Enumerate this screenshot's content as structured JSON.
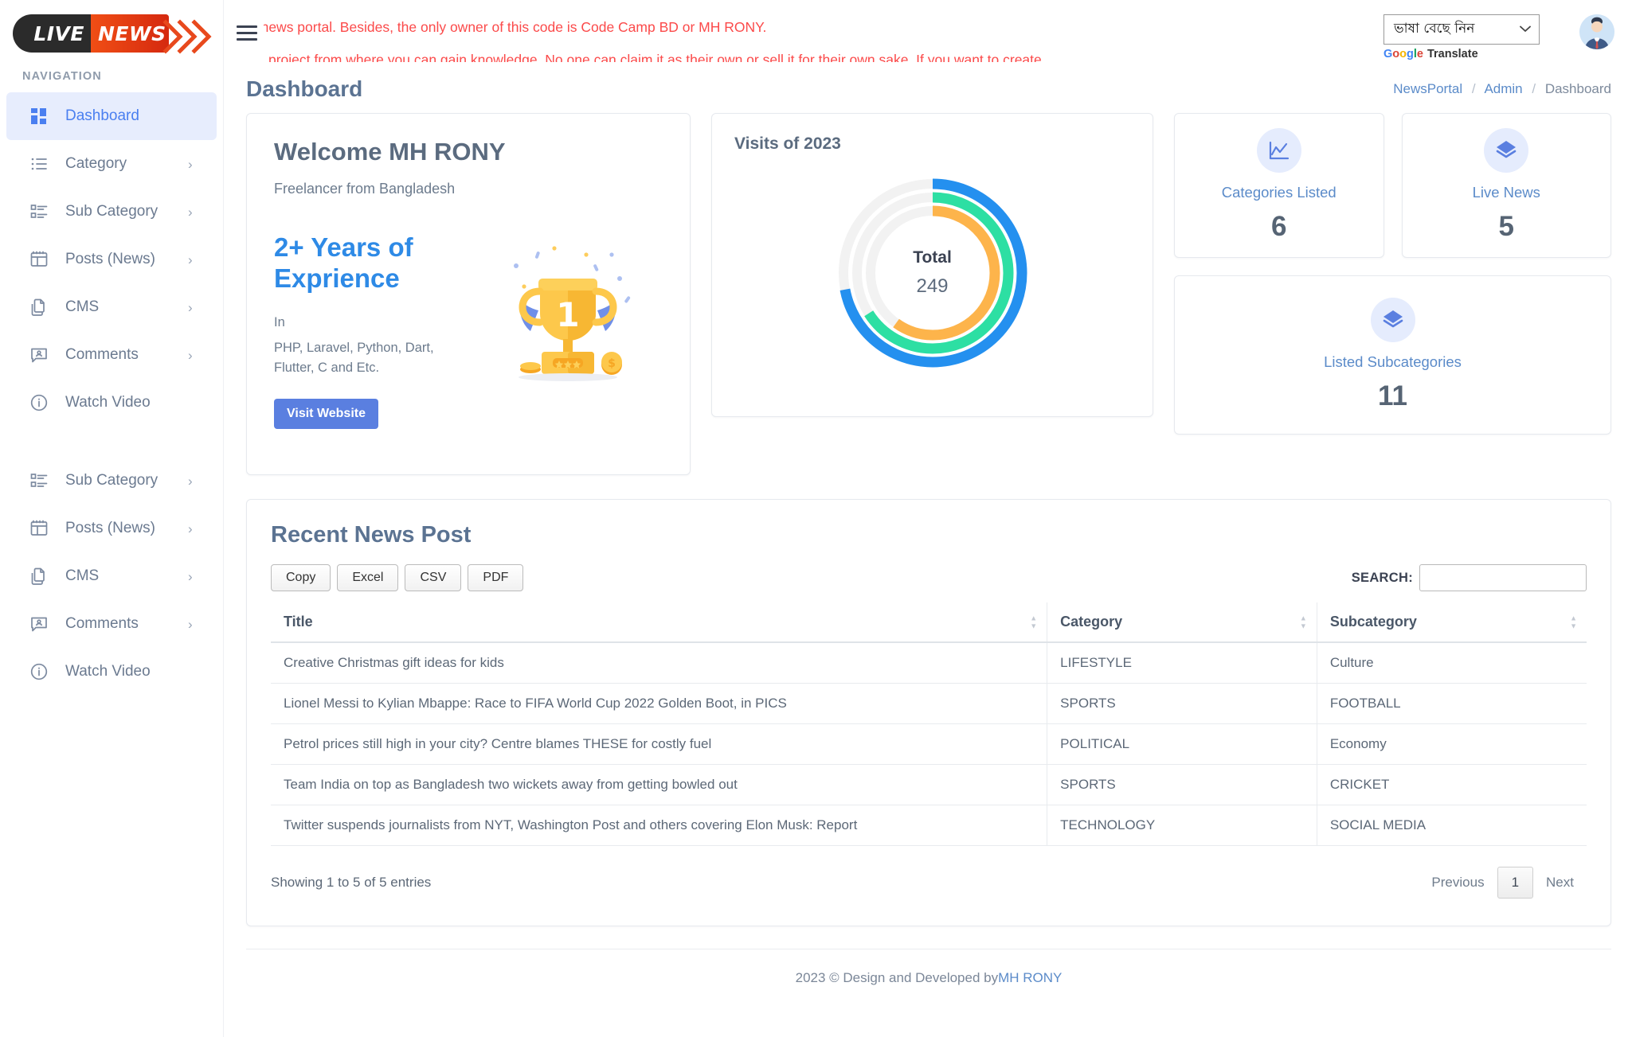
{
  "brand": {
    "logo_left": "LIVE",
    "logo_right": "NEWS"
  },
  "sidebar": {
    "heading": "NAVIGATION",
    "items": [
      {
        "label": "Dashboard",
        "icon": "grid-icon",
        "arrow": "",
        "active": true
      },
      {
        "label": "Category",
        "icon": "list-icon",
        "arrow": "›",
        "active": false
      },
      {
        "label": "Sub Category",
        "icon": "sub-list-icon",
        "arrow": "›",
        "active": false
      },
      {
        "label": "Posts (News)",
        "icon": "table-icon",
        "arrow": "›",
        "active": false
      },
      {
        "label": "CMS",
        "icon": "copy-files-icon",
        "arrow": "›",
        "active": false
      },
      {
        "label": "Comments",
        "icon": "comment-icon",
        "arrow": "›",
        "active": false
      },
      {
        "label": "Watch Video",
        "icon": "info-circle-icon",
        "arrow": "",
        "active": false
      }
    ],
    "items2": [
      {
        "label": "Sub Category",
        "icon": "sub-list-icon",
        "arrow": "›"
      },
      {
        "label": "Posts (News)",
        "icon": "table-icon",
        "arrow": "›"
      },
      {
        "label": "CMS",
        "icon": "copy-files-icon",
        "arrow": "›"
      },
      {
        "label": "Comments",
        "icon": "comment-icon",
        "arrow": "›"
      },
      {
        "label": "Watch Video",
        "icon": "info-circle-icon",
        "arrow": ""
      }
    ]
  },
  "topbar": {
    "marquee_line1": "e news portal. Besides, the only owner of this code is Code Camp BD or MH RONY.",
    "marquee_line2": "project from where you can gain knowledge. No one can claim it as their own or sell it for their own sake. If you want to create",
    "marquee_color": "#fb4a4a",
    "translate": {
      "selected": "ভাষা বেছে নিন",
      "chevron": "⌄",
      "brand_google": "Google",
      "brand_translate": "Translate"
    }
  },
  "page": {
    "title": "Dashboard",
    "breadcrumb": [
      {
        "label": "NewsPortal",
        "link": true
      },
      {
        "label": "Admin",
        "link": true
      },
      {
        "label": "Dashboard",
        "link": false
      }
    ],
    "separator": "/"
  },
  "welcome": {
    "title": "Welcome MH RONY",
    "subtitle": "Freelancer from Bangladesh",
    "years": "2+ Years of Exprience",
    "in_label": "In",
    "stack": "PHP, Laravel, Python, Dart, Flutter, C and Etc.",
    "button": "Visit Website",
    "accent": "#2e8ae6",
    "button_color": "#5a7fe0"
  },
  "chart_data": {
    "type": "pie",
    "title": "Visits of 2023",
    "center_label": "Total",
    "center_value": "249",
    "series": [
      {
        "name": "ring-outer",
        "value": 72,
        "color": "#2490ef"
      },
      {
        "name": "ring-middle",
        "value": 66,
        "color": "#2ddfa3"
      },
      {
        "name": "ring-inner",
        "value": 60,
        "color": "#fdb44b"
      }
    ],
    "track_color": "#f2f2f2",
    "ylim": [
      0,
      100
    ],
    "legend": "none",
    "grid": false
  },
  "stats": [
    {
      "label": "Categories Listed",
      "value": "6",
      "icon": "chart-line-icon"
    },
    {
      "label": "Live News",
      "value": "5",
      "icon": "layers-icon"
    },
    {
      "label": "Listed Subcategories",
      "value": "11",
      "icon": "layers-icon"
    }
  ],
  "news": {
    "title": "Recent News Post",
    "export_buttons": [
      "Copy",
      "Excel",
      "CSV",
      "PDF"
    ],
    "search_label": "SEARCH:",
    "search_value": "",
    "search_placeholder": "",
    "columns": [
      "Title",
      "Category",
      "Subcategory"
    ],
    "rows": [
      {
        "title": "Creative Christmas gift ideas for kids",
        "category": "LIFESTYLE",
        "subcategory": "Culture"
      },
      {
        "title": "Lionel Messi to Kylian Mbappe: Race to FIFA World Cup 2022 Golden Boot, in PICS",
        "category": "SPORTS",
        "subcategory": "FOOTBALL"
      },
      {
        "title": "Petrol prices still high in your city? Centre blames THESE for costly fuel",
        "category": "POLITICAL",
        "subcategory": "Economy"
      },
      {
        "title": "Team India on top as Bangladesh two wickets away from getting bowled out",
        "category": "SPORTS",
        "subcategory": "CRICKET"
      },
      {
        "title": "Twitter suspends journalists from NYT, Washington Post and others covering Elon Musk: Report",
        "category": "TECHNOLOGY",
        "subcategory": "SOCIAL MEDIA"
      }
    ],
    "entries_info": "Showing 1 to 5 of 5 entries",
    "pagination": {
      "previous": "Previous",
      "current": "1",
      "next": "Next"
    }
  },
  "footer": {
    "text": "2023 © Design and Developed by ",
    "author": "MH RONY"
  }
}
